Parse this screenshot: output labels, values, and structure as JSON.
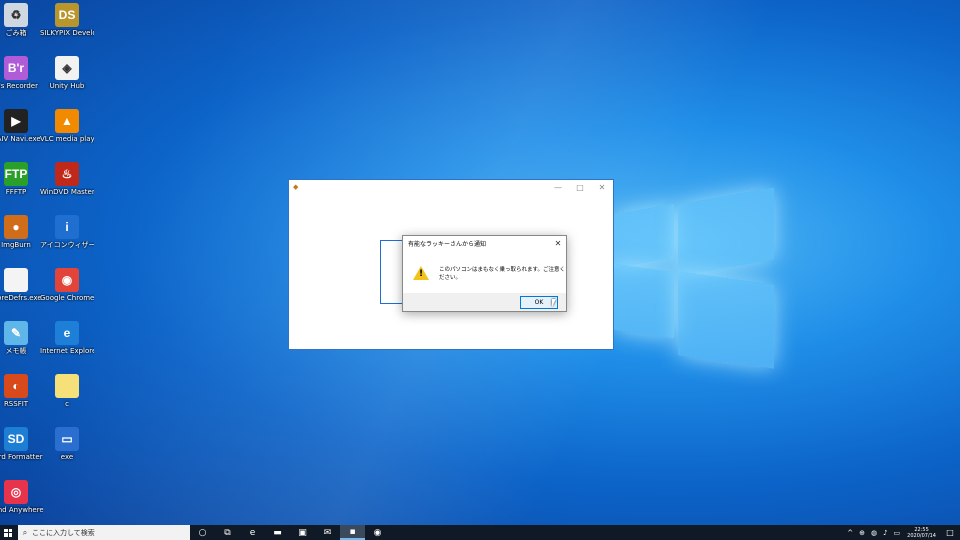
{
  "desktop": {
    "icons_col1": [
      {
        "label": "ごみ箱",
        "icon": "recycle-bin-icon",
        "bg": "#cfd8e0",
        "glyph": "♻"
      },
      {
        "label": "B's Recorder",
        "icon": "bsrecorder-icon",
        "bg": "#b05bd8",
        "glyph": "B'r"
      },
      {
        "label": "DAIV Navi.exe",
        "icon": "daiv-navi-icon",
        "bg": "#222",
        "glyph": "▶"
      },
      {
        "label": "FFFTP",
        "icon": "ffftp-icon",
        "bg": "#2aa02a",
        "glyph": "FTP"
      },
      {
        "label": "ImgBurn",
        "icon": "imgburn-icon",
        "bg": "#d06d1a",
        "glyph": "●"
      },
      {
        "label": "moreDefrs.exe",
        "icon": "file-icon",
        "bg": "#f4f4f4",
        "glyph": ""
      },
      {
        "label": "メモ帳",
        "icon": "notepad-icon",
        "bg": "#5fb6e8",
        "glyph": "✎"
      },
      {
        "label": "RSSFIT",
        "icon": "rssfit-icon",
        "bg": "#d84a1b",
        "glyph": "◐"
      },
      {
        "label": "Card Formatter",
        "icon": "card-formatter-icon",
        "bg": "#1d7fd4",
        "glyph": "SD"
      },
      {
        "label": "Send Anywhere",
        "icon": "send-anywhere-icon",
        "bg": "#e8334d",
        "glyph": "◎"
      }
    ],
    "icons_col2": [
      {
        "label": "SILKYPIX Developer Studio",
        "icon": "silkypix-icon",
        "bg": "#b8962c",
        "glyph": "DS"
      },
      {
        "label": "Unity Hub",
        "icon": "unity-hub-icon",
        "bg": "#f2f2f2",
        "glyph": "◈"
      },
      {
        "label": "VLC media player",
        "icon": "vlc-icon",
        "bg": "#f28a00",
        "glyph": "▲"
      },
      {
        "label": "WinDVD Master",
        "icon": "windvd-icon",
        "bg": "#c0281a",
        "glyph": "♨"
      },
      {
        "label": "アイコンウィザード",
        "icon": "info-icon",
        "bg": "#1e6fd0",
        "glyph": "i"
      },
      {
        "label": "Google Chrome",
        "icon": "chrome-icon",
        "bg": "#e3443a",
        "glyph": "◉"
      },
      {
        "label": "Internet Explorer",
        "icon": "ie-icon",
        "bg": "#1e7fd8",
        "glyph": "e"
      },
      {
        "label": "c",
        "icon": "folder-file-icon",
        "bg": "#f5e07a",
        "glyph": ""
      },
      {
        "label": "exe",
        "icon": "exe-icon",
        "bg": "#2a6fd0",
        "glyph": "▭"
      }
    ]
  },
  "app_window": {
    "title": "",
    "controls": [
      "—",
      "□",
      "✕"
    ]
  },
  "dialog": {
    "title": "有能なラッキーさんから通知",
    "close": "✕",
    "message": "このパソコンはまもなく乗っ取られます。ご注意ください。",
    "warning_glyph": "!",
    "ok_label": "OK"
  },
  "taskbar": {
    "search_placeholder": "ここに入力して検索",
    "items": [
      {
        "name": "cortana",
        "glyph": "○"
      },
      {
        "name": "task-view",
        "glyph": "⧉"
      },
      {
        "name": "edge",
        "glyph": "e"
      },
      {
        "name": "explorer",
        "glyph": "▬"
      },
      {
        "name": "store",
        "glyph": "▣"
      },
      {
        "name": "mail",
        "glyph": "✉"
      },
      {
        "name": "app",
        "glyph": "▪"
      },
      {
        "name": "chrome",
        "glyph": "◉"
      }
    ],
    "tray_icons": [
      "^",
      "⊕",
      "◍",
      "♪",
      "▭"
    ],
    "time": "22:55",
    "date": "2020/07/14",
    "notification": "□"
  }
}
